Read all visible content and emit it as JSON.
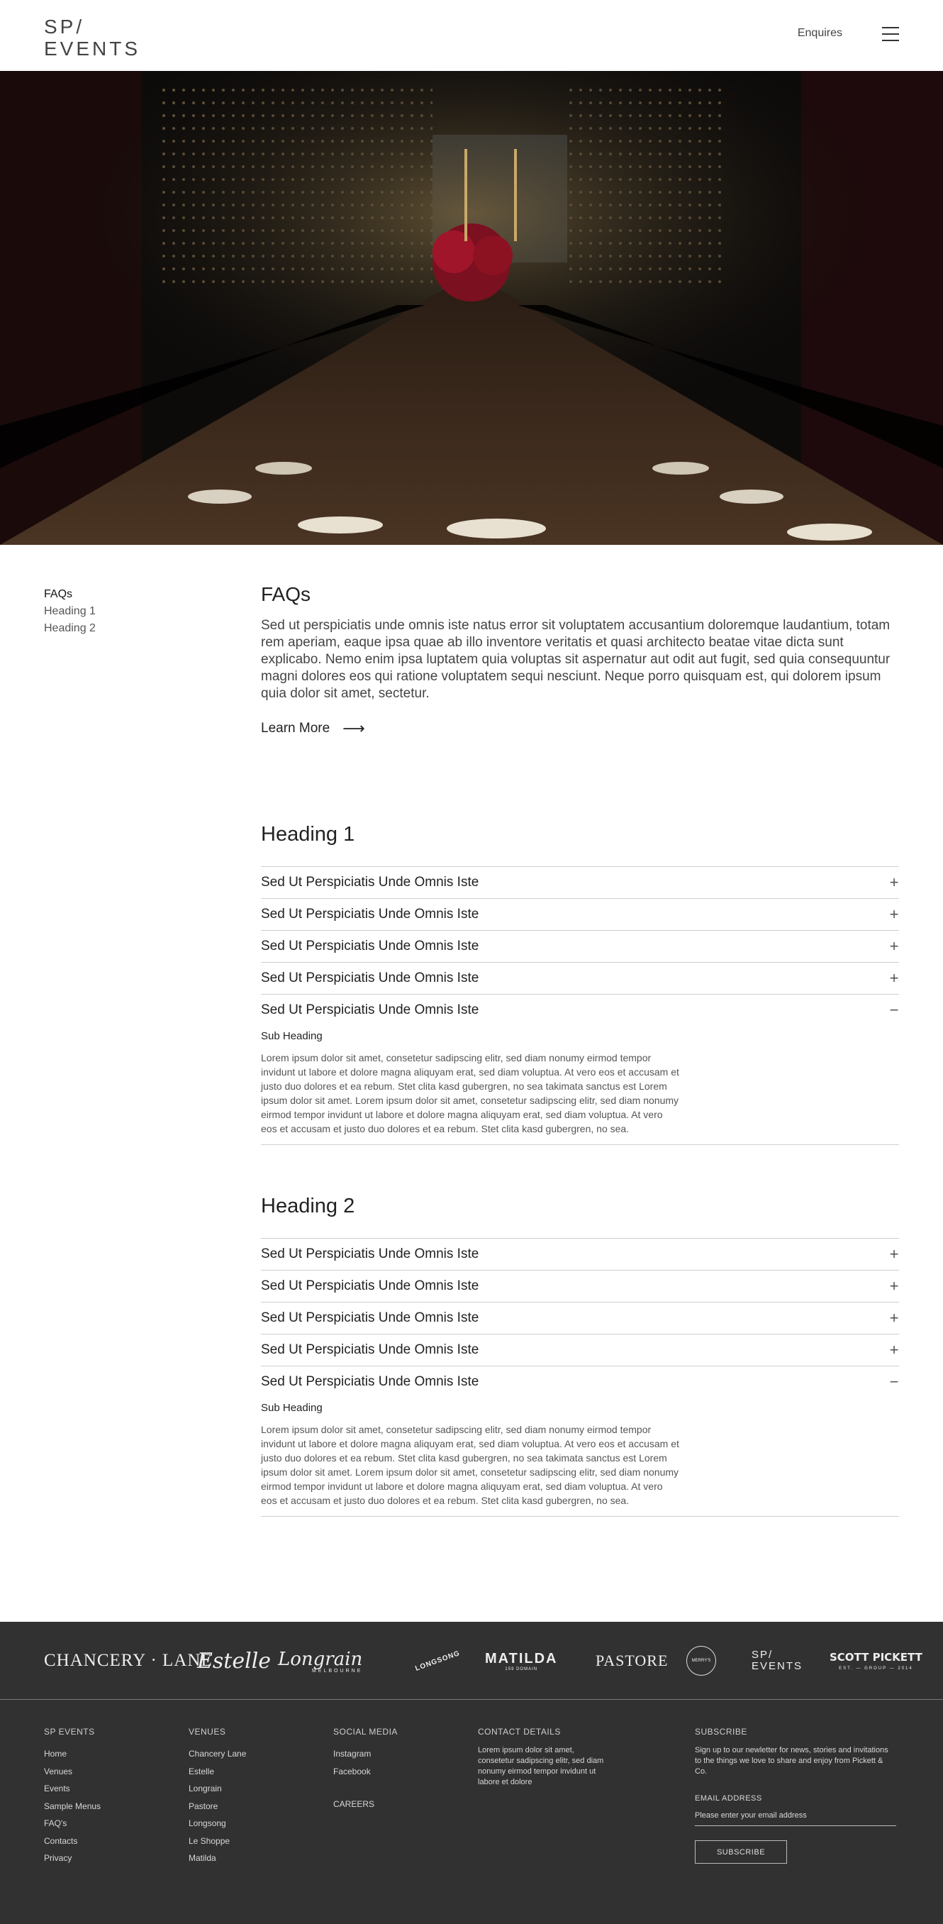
{
  "header": {
    "logo_line1": "SP/",
    "logo_line2": "EVENTS",
    "enquires": "Enquires",
    "menu_icon": "hamburger-menu-icon"
  },
  "side_nav": [
    "FAQs",
    "Heading 1",
    "Heading 2"
  ],
  "faq": {
    "title": "FAQs",
    "intro": "Sed ut perspiciatis unde omnis iste natus error sit voluptatem accusantium doloremque laudantium, totam rem aperiam, eaque ipsa quae ab illo inventore veritatis et quasi architecto beatae vitae dicta sunt explicabo. Nemo enim ipsa luptatem quia voluptas sit aspernatur aut odit aut fugit, sed quia consequuntur magni dolores eos qui ratione voluptatem sequi nesciunt. Neque porro quisquam est, qui dolorem ipsum quia dolor sit amet, sectetur.",
    "learn_more": "Learn More",
    "arrow": "⟶"
  },
  "groups": [
    {
      "heading": "Heading 1",
      "items": [
        {
          "question": "Sed Ut Perspiciatis Unde Omnis Iste",
          "sign": "+"
        },
        {
          "question": "Sed Ut Perspiciatis Unde Omnis Iste",
          "sign": "+"
        },
        {
          "question": "Sed Ut Perspiciatis Unde Omnis Iste",
          "sign": "+"
        },
        {
          "question": "Sed Ut Perspiciatis Unde Omnis Iste",
          "sign": "+"
        },
        {
          "question": "Sed Ut Perspiciatis Unde Omnis Iste",
          "sign": "−",
          "sub_heading": "Sub Heading",
          "body": "Lorem ipsum dolor sit amet, consetetur sadipscing elitr, sed diam nonumy eirmod tempor invidunt ut labore et dolore magna aliquyam erat, sed diam voluptua. At vero eos et accusam et justo duo dolores et ea rebum. Stet clita kasd gubergren, no sea takimata sanctus est Lorem ipsum dolor sit amet. Lorem ipsum dolor sit amet, consetetur sadipscing elitr, sed diam nonumy eirmod tempor invidunt ut labore et dolore magna aliquyam erat, sed diam voluptua. At vero eos et accusam et justo duo dolores et ea rebum. Stet clita kasd gubergren, no sea."
        }
      ]
    },
    {
      "heading": "Heading 2",
      "items": [
        {
          "question": "Sed Ut Perspiciatis Unde Omnis Iste",
          "sign": "+"
        },
        {
          "question": "Sed Ut Perspiciatis Unde Omnis Iste",
          "sign": "+"
        },
        {
          "question": "Sed Ut Perspiciatis Unde Omnis Iste",
          "sign": "+"
        },
        {
          "question": "Sed Ut Perspiciatis Unde Omnis Iste",
          "sign": "+"
        },
        {
          "question": "Sed Ut Perspiciatis Unde Omnis Iste",
          "sign": "−",
          "sub_heading": "Sub Heading",
          "body": "Lorem ipsum dolor sit amet, consetetur sadipscing elitr, sed diam nonumy eirmod tempor invidunt ut labore et dolore magna aliquyam erat, sed diam voluptua. At vero eos et accusam et justo duo dolores et ea rebum. Stet clita kasd gubergren, no sea takimata sanctus est Lorem ipsum dolor sit amet. Lorem ipsum dolor sit amet, consetetur sadipscing elitr, sed diam nonumy eirmod tempor invidunt ut labore et dolore magna aliquyam erat, sed diam voluptua. At vero eos et accusam et justo duo dolores et ea rebum. Stet clita kasd gubergren, no sea."
        }
      ]
    }
  ],
  "brands": {
    "chancery": "CHANCERY · LANE",
    "estelle": "Estelle",
    "longrain": "Longrain",
    "longrain_sub": "MELBOURNE",
    "longsong": "LONGSONG",
    "matilda": "MATILDA",
    "matilda_sub": "159 DOMAIN",
    "pastore": "PASTORE",
    "le_shoppe": "MERRY'S",
    "sp_line1": "SP/",
    "sp_line2": "EVENTS",
    "scott": "SCOTT PICKETT",
    "scott_sub": "EST. — GROUP — 2014"
  },
  "footer": {
    "sp_events": {
      "title": "SP EVENTS",
      "links": [
        "Home",
        "Venues",
        "Events",
        "Sample Menus",
        "FAQ's",
        "Contacts",
        "Privacy"
      ]
    },
    "venues": {
      "title": "VENUES",
      "links": [
        "Chancery Lane",
        "Estelle",
        "Longrain",
        "Pastore",
        "Longsong",
        "Le Shoppe",
        "Matilda"
      ]
    },
    "social": {
      "title": "SOCIAL MEDIA",
      "links": [
        "Instagram",
        "Facebook"
      ],
      "careers": "CAREERS"
    },
    "contact": {
      "title": "CONTACT DETAILS",
      "text": "Lorem ipsum dolor sit amet, consetetur sadipscing elitr, sed diam nonumy eirmod tempor invidunt ut labore et dolore"
    },
    "subscribe": {
      "title": "SUBSCRIBE",
      "text": "Sign up to our newletter for news, stories and invitations to the things we love to share and enjoy from Pickett & Co.",
      "email_label": "EMAIL ADDRESS",
      "email_placeholder": "Please enter your email address",
      "button": "SUBSCRIBE"
    }
  },
  "colors": {
    "footer_bg": "#313131",
    "text_dark": "#222222",
    "divider": "#cfcfcf"
  }
}
